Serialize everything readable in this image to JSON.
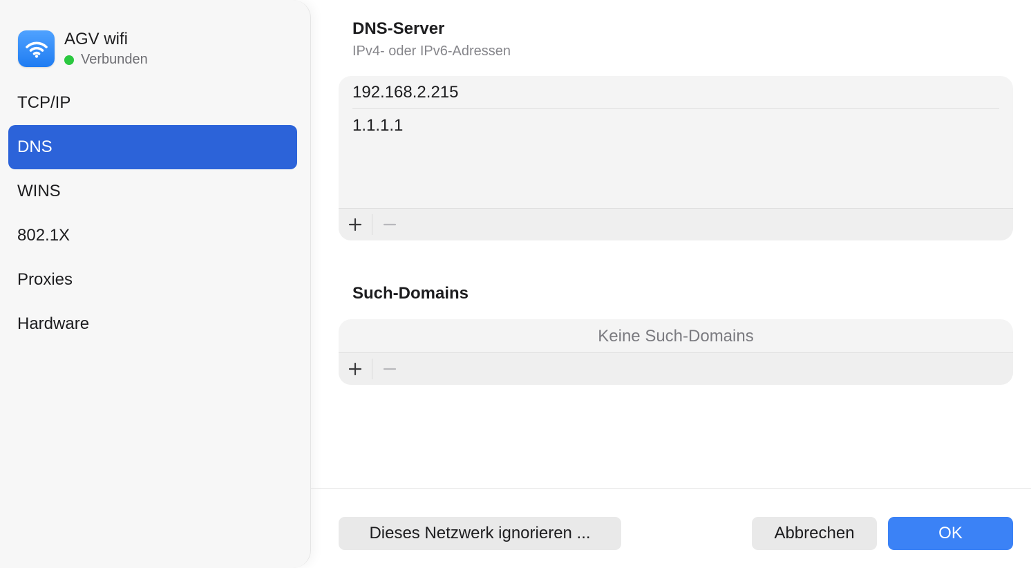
{
  "sidebar": {
    "network_name": "AGV wifi",
    "status": "Verbunden",
    "items": [
      {
        "label": "TCP/IP"
      },
      {
        "label": "DNS"
      },
      {
        "label": "WINS"
      },
      {
        "label": "802.1X"
      },
      {
        "label": "Proxies"
      },
      {
        "label": "Hardware"
      }
    ],
    "active_item": "DNS"
  },
  "dns": {
    "title": "DNS-Server",
    "subtitle": "IPv4- oder IPv6-Adressen",
    "servers": [
      "192.168.2.215",
      "1.1.1.1"
    ]
  },
  "search_domains": {
    "title": "Such-Domains",
    "empty_text": "Keine Such-Domains"
  },
  "buttons": {
    "forget": "Dieses Netzwerk ignorieren ...",
    "cancel": "Abbrechen",
    "ok": "OK"
  },
  "colors": {
    "accent": "#2c63d9",
    "status_connected": "#2bc840",
    "primary_button": "#3b82f6"
  },
  "icons": {
    "network": "wifi-icon",
    "add": "plus-icon",
    "remove": "minus-icon"
  }
}
